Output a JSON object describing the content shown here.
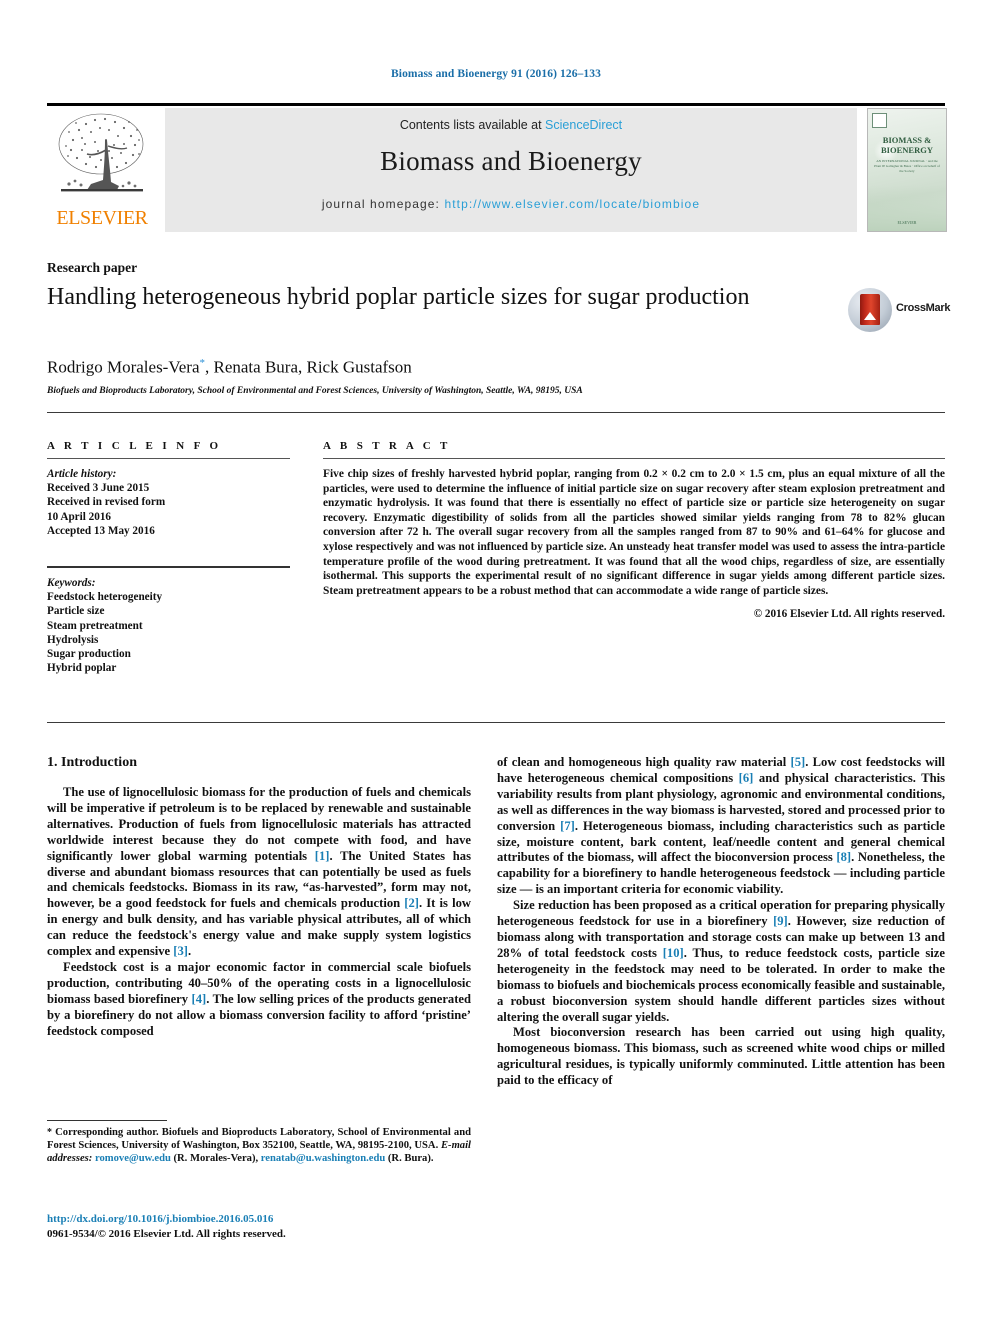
{
  "running_head": "Biomass and Bioenergy 91 (2016) 126–133",
  "header": {
    "contents_prefix": "Contents lists available at ",
    "sciencedirect": "ScienceDirect",
    "journal_name": "Biomass and Bioenergy",
    "homepage_label": "journal homepage:",
    "homepage_url": "http://www.elsevier.com/locate/biombioe",
    "publisher": "ELSEVIER",
    "cover": {
      "title_line1": "BIOMASS &",
      "title_line2": "BIOENERGY",
      "subtitle": "AN INTERNATIONAL JOURNAL · and the Plant JP Gallagher & Bates · Office on behalf of the Society",
      "footer": "ELSEVIER"
    },
    "accent_link_color": "#2a9fd6",
    "band_color": "#e8e8e8"
  },
  "article": {
    "doctype": "Research paper",
    "title": "Handling heterogeneous hybrid poplar particle sizes for sugar production",
    "authors": "Rodrigo Morales-Vera",
    "authors_rest": ", Renata Bura, Rick Gustafson",
    "corresponding_marker": "*",
    "affiliation": "Biofuels and Bioproducts Laboratory, School of Environmental and Forest Sciences, University of Washington, Seattle, WA, 98195, USA",
    "crossmark_label": "CrossMark"
  },
  "article_info": {
    "heading": "A R T I C L E  I N F O",
    "history_label": "Article history:",
    "history": [
      "Received 3 June 2015",
      "Received in revised form",
      "10 April 2016",
      "Accepted 13 May 2016"
    ],
    "keywords_label": "Keywords:",
    "keywords": [
      "Feedstock heterogeneity",
      "Particle size",
      "Steam pretreatment",
      "Hydrolysis",
      "Sugar production",
      "Hybrid poplar"
    ]
  },
  "abstract": {
    "heading": "A B S T R A C T",
    "text": "Five chip sizes of freshly harvested hybrid poplar, ranging from 0.2 × 0.2 cm to 2.0 × 1.5 cm, plus an equal mixture of all the particles, were used to determine the influence of initial particle size on sugar recovery after steam explosion pretreatment and enzymatic hydrolysis. It was found that there is essentially no effect of particle size or particle size heterogeneity on sugar recovery. Enzymatic digestibility of solids from all the particles showed similar yields ranging from 78 to 82% glucan conversion after 72 h. The overall sugar recovery from all the samples ranged from 87 to 90% and 61–64% for glucose and xylose respectively and was not influenced by particle size. An unsteady heat transfer model was used to assess the intra-particle temperature profile of the wood during pretreatment. It was found that all the wood chips, regardless of size, are essentially isothermal. This supports the experimental result of no significant difference in sugar yields among different particle sizes. Steam pretreatment appears to be a robust method that can accommodate a wide range of particle sizes.",
    "copyright": "© 2016 Elsevier Ltd. All rights reserved."
  },
  "body": {
    "section_heading": "1. Introduction",
    "left_paragraphs": [
      {
        "parts": [
          {
            "t": "The use of lignocellulosic biomass for the production of fuels and chemicals will be imperative if petroleum is to be replaced by renewable and sustainable alternatives. Production of fuels from lignocellulosic materials has attracted worldwide interest because they do not compete with food, and have significantly lower global warming potentials "
          },
          {
            "t": "[1]",
            "ref": true
          },
          {
            "t": ". The United States has diverse and abundant biomass resources that can potentially be used as fuels and chemicals feedstocks. Biomass in its raw, “as-harvested”, form may not, however, be a good feedstock for fuels and chemicals production "
          },
          {
            "t": "[2]",
            "ref": true
          },
          {
            "t": ". It is low in energy and bulk density, and has variable physical attributes, all of which can reduce the feedstock's energy value and make supply system logistics complex and expensive "
          },
          {
            "t": "[3]",
            "ref": true
          },
          {
            "t": "."
          }
        ]
      },
      {
        "parts": [
          {
            "t": "Feedstock cost is a major economic factor in commercial scale biofuels production, contributing 40–50% of the operating costs in a lignocellulosic biomass based biorefinery "
          },
          {
            "t": "[4]",
            "ref": true
          },
          {
            "t": ". The low selling prices of the products generated by a biorefinery do not allow a biomass conversion facility to afford ‘pristine’ feedstock composed"
          }
        ]
      }
    ],
    "right_paragraphs": [
      {
        "continued": true,
        "parts": [
          {
            "t": "of clean and homogeneous high quality raw material "
          },
          {
            "t": "[5]",
            "ref": true
          },
          {
            "t": ". Low cost feedstocks will have heterogeneous chemical compositions "
          },
          {
            "t": "[6]",
            "ref": true
          },
          {
            "t": " and physical characteristics. This variability results from plant physiology, agronomic and environmental conditions, as well as differences in the way biomass is harvested, stored and processed prior to conversion "
          },
          {
            "t": "[7]",
            "ref": true
          },
          {
            "t": ". Heterogeneous biomass, including characteristics such as particle size, moisture content, bark content, leaf/needle content and general chemical attributes of the biomass, will affect the bioconversion process "
          },
          {
            "t": "[8]",
            "ref": true
          },
          {
            "t": ". Nonetheless, the capability for a biorefinery to handle heterogeneous feedstock — including particle size — is an important criteria for economic viability."
          }
        ]
      },
      {
        "parts": [
          {
            "t": "Size reduction has been proposed as a critical operation for preparing physically heterogeneous feedstock for use in a biorefinery "
          },
          {
            "t": "[9]",
            "ref": true
          },
          {
            "t": ". However, size reduction of biomass along with transportation and storage costs can make up between 13 and 28% of total feedstock costs "
          },
          {
            "t": "[10]",
            "ref": true
          },
          {
            "t": ". Thus, to reduce feedstock costs, particle size heterogeneity in the feedstock may need to be tolerated. In order to make the biomass to biofuels and biochemicals process economically feasible and sustainable, a robust bioconversion system should handle different particles sizes without altering the overall sugar yields."
          }
        ]
      },
      {
        "parts": [
          {
            "t": "Most bioconversion research has been carried out using high quality, homogeneous biomass. This biomass, such as screened white wood chips or milled agricultural residues, is typically uniformly comminuted. Little attention has been paid to the efficacy of"
          }
        ]
      }
    ]
  },
  "footnote": {
    "marker": "*",
    "text_before_emails": " Corresponding author. Biofuels and Bioproducts Laboratory, School of Environmental and Forest Sciences, University of Washington, Box 352100, Seattle, WA, 98195-2100, USA.",
    "email_label": "E-mail addresses:",
    "email_1": "romove@uw.edu",
    "email_1_owner": " (R. Morales-Vera), ",
    "email_2": "renatab@u.washington.edu",
    "email_2_owner": " (R. Bura)."
  },
  "doi_block": {
    "doi": "http://dx.doi.org/10.1016/j.biombioe.2016.05.016",
    "issn_line": "0961-9534/© 2016 Elsevier Ltd. All rights reserved."
  }
}
